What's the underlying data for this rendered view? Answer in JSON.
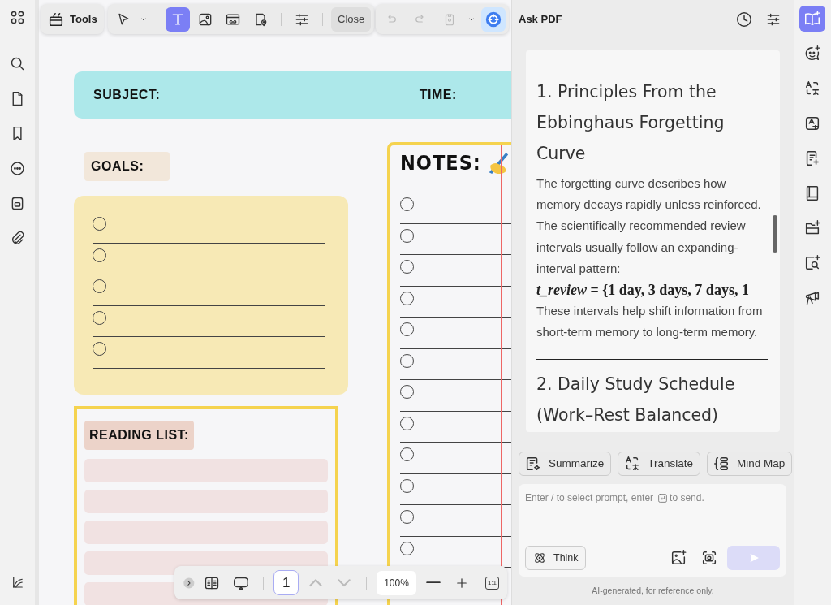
{
  "toolbar": {
    "tools_label": "Tools",
    "edit_tools": [
      {
        "selected": false
      },
      {
        "selected": true
      },
      {
        "selected": false
      },
      {
        "selected": false
      },
      {
        "selected": false
      }
    ],
    "close_label": "Close",
    "history": [
      {
        "disabled": true
      },
      {
        "disabled": true
      },
      {
        "disabled": true
      }
    ]
  },
  "document": {
    "subject_label": "SUBJECT:",
    "time_label": "TIME:",
    "goals_label": "GOALS:",
    "goals": [
      {
        "checked": false
      },
      {
        "checked": false
      },
      {
        "checked": false
      },
      {
        "checked": false
      },
      {
        "checked": false
      }
    ],
    "notes_label": "NOTES:",
    "notes": [
      {
        "checked": false
      },
      {
        "checked": false
      },
      {
        "checked": false
      },
      {
        "checked": false
      },
      {
        "checked": false
      },
      {
        "checked": false
      },
      {
        "checked": false
      },
      {
        "checked": false
      },
      {
        "checked": false
      },
      {
        "checked": false
      },
      {
        "checked": false
      },
      {
        "checked": false
      }
    ],
    "reading_label": "READING LIST:"
  },
  "bottom_bar": {
    "page": "1",
    "page_up": {
      "disabled": true
    },
    "page_down": {
      "disabled": true
    },
    "zoom": "100%",
    "zoom_reset": "1:1"
  },
  "ask_pdf": {
    "title": "Ask PDF",
    "blocks": [
      {
        "kind": "rule"
      },
      {
        "kind": "heading",
        "text": "1. Principles From the Ebbinghaus Forgetting Curve"
      },
      {
        "kind": "paragraph",
        "text": "The forgetting curve describes how memory decays rapidly unless reinforced. The scientifically recommended review intervals usually follow an expanding-interval pattern:"
      },
      {
        "kind": "formula",
        "text": "*t_review* = {1 day,  3 days,  7 days,  1"
      },
      {
        "kind": "paragraph",
        "text": "These intervals help shift information from short-term memory to long-term memory."
      },
      {
        "kind": "rule"
      },
      {
        "kind": "heading",
        "text": "2. Daily Study Schedule (Work–Rest Balanced)"
      }
    ],
    "actions": [
      "Summarize",
      "Translate",
      "Mind Map"
    ],
    "prompt": {
      "hint_before": "Enter / to select prompt, enter",
      "hint_after": "to send."
    },
    "think_label": "Think",
    "send": {
      "disabled": true
    },
    "footer": "AI-generated, for reference only."
  },
  "right_rail": [
    {
      "selected": true
    },
    {
      "selected": false
    },
    {
      "selected": false
    },
    {
      "selected": false
    },
    {
      "selected": false
    },
    {
      "selected": false
    },
    {
      "selected": false
    },
    {
      "selected": false
    },
    {
      "selected": false
    }
  ]
}
